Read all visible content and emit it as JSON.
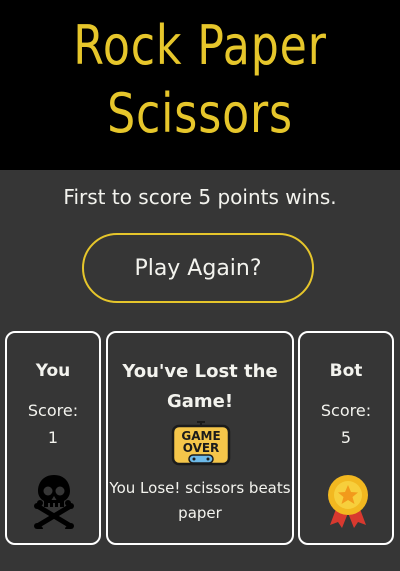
{
  "header": {
    "title_line1": "Rock Paper",
    "title_line2": "Scissors"
  },
  "rules": {
    "text": "First to score 5 points wins."
  },
  "controls": {
    "play_again_label": "Play Again?"
  },
  "player": {
    "label": "You",
    "score_label": "Score:",
    "score": "1",
    "icon": "skull-crossbones-icon"
  },
  "outcome": {
    "title": "You've Lost the Game!",
    "icon": "game-over-icon",
    "icon_text_line1": "GAME",
    "icon_text_line2": "OVER",
    "round_result": "You Lose! scissors beats paper"
  },
  "bot": {
    "label": "Bot",
    "score_label": "Score:",
    "score": "5",
    "icon": "gold-medal-icon"
  },
  "colors": {
    "background": "#363636",
    "header_bg": "#000000",
    "accent": "#e6c62b",
    "text": "#f3f3ee",
    "panel_border": "#ffffff"
  }
}
